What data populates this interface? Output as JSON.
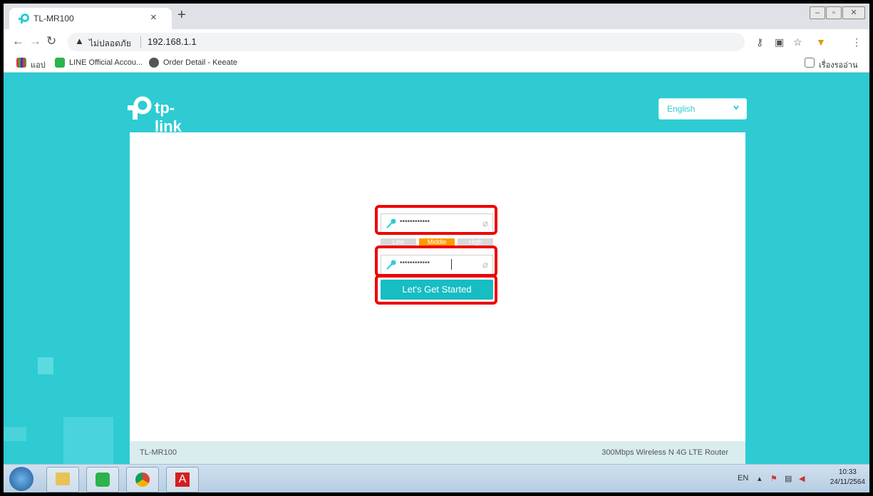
{
  "browser": {
    "tab_title": "TL-MR100",
    "tab_close": "×",
    "new_tab": "+",
    "security_label": "ไม่ปลอดภัย",
    "url": "192.168.1.1",
    "bookmarks": [
      {
        "label": "แอป"
      },
      {
        "label": "LINE Official Accou..."
      },
      {
        "label": "Order Detail - Keeate"
      }
    ],
    "reading_list": "เรื่องรออ่าน"
  },
  "page": {
    "logo_text": "tp-link",
    "language": "English",
    "password_mask": "••••••••••••",
    "confirm_mask": "••••••••••••",
    "strength": {
      "low": "Low",
      "middle": "Middle",
      "high": "High"
    },
    "start_button": "Let's Get Started",
    "footer_model": "TL-MR100",
    "footer_desc": "300Mbps Wireless N 4G LTE Router"
  },
  "taskbar": {
    "lang": "EN",
    "time": "10:33",
    "date": "24/11/2564"
  },
  "colors": {
    "accent": "#2ecbd3",
    "button": "#16bdc3",
    "highlight": "#e00000",
    "strength_low": "#d8d8d8",
    "strength_middle": "#ff9900",
    "strength_high": "#d8d8d8"
  }
}
